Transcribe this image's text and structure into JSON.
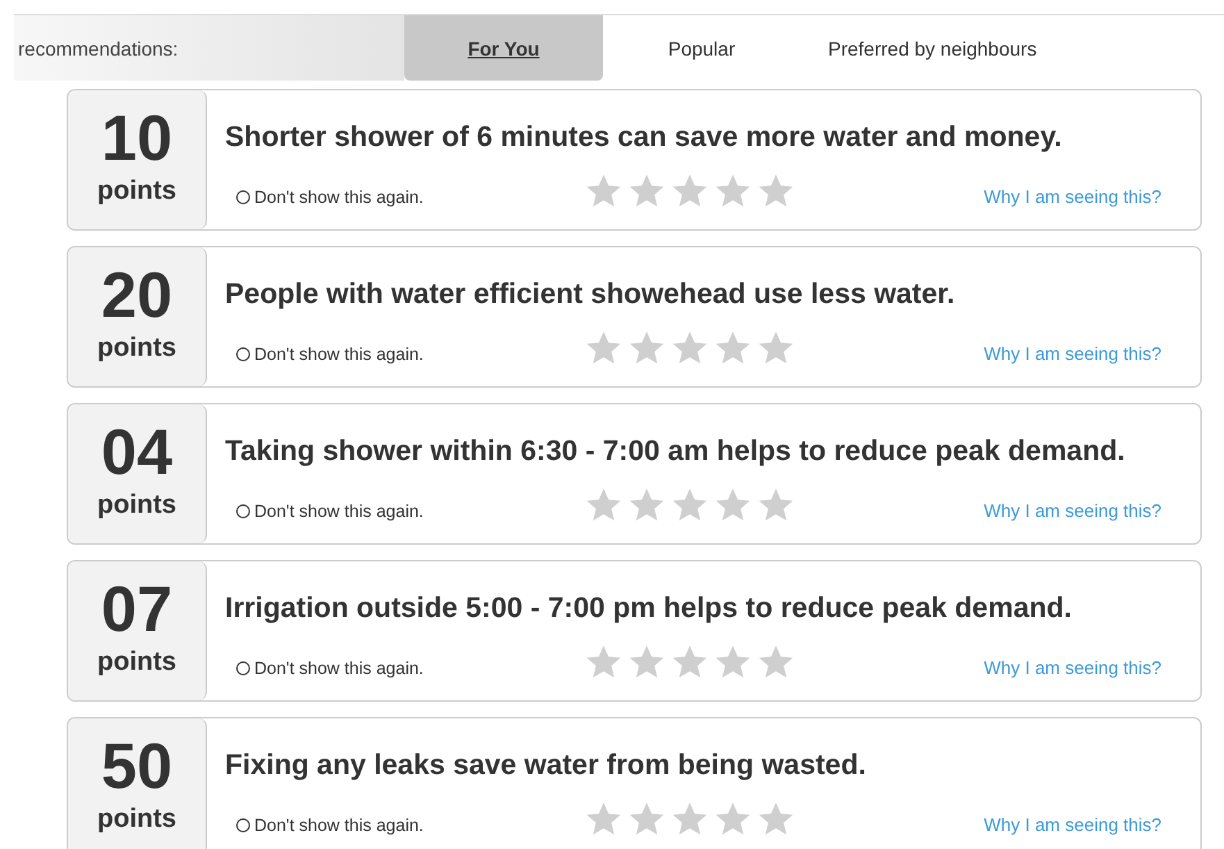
{
  "header": {
    "label": "recommendations:"
  },
  "tabs": [
    {
      "label": "For You",
      "selected": true
    },
    {
      "label": "Popular",
      "selected": false
    },
    {
      "label": "Preferred by neighbours",
      "selected": false
    }
  ],
  "cards": [
    {
      "points": "10",
      "unit": "points",
      "title": "Shorter shower of 6 minutes can save more water and money.",
      "dismiss": {
        "label": "Don't show this again.",
        "checked": false
      },
      "stars": 0,
      "link": "Why I am seeing this?"
    },
    {
      "points": "20",
      "unit": "points",
      "title": "People with water efficient showehead use less water.",
      "dismiss": {
        "label": "Don't show this again.",
        "checked": false
      },
      "stars": 0,
      "link": "Why I am seeing this?"
    },
    {
      "points": "04",
      "unit": "points",
      "title": "Taking shower within 6:30 - 7:00 am helps to reduce peak demand.",
      "dismiss": {
        "label": "Don't show this again.",
        "checked": false
      },
      "stars": 0,
      "link": "Why I am seeing this?"
    },
    {
      "points": "07",
      "unit": "points",
      "title": "Irrigation outside 5:00 - 7:00 pm helps to reduce peak demand.",
      "dismiss": {
        "label": "Don't show this again.",
        "checked": false
      },
      "stars": 0,
      "link": "Why I am seeing this?"
    },
    {
      "points": "50",
      "unit": "points",
      "title": "Fixing any leaks save water from being wasted.",
      "dismiss": {
        "label": "Don't show this again.",
        "checked": false
      },
      "stars": 0,
      "link": "Why I am seeing this?"
    }
  ]
}
